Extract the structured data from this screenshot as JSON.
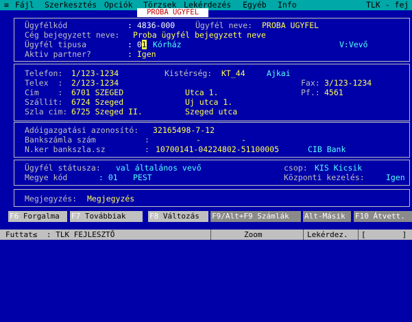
{
  "menu": {
    "system": "≡",
    "items": [
      "Fájl",
      "Szerkesztés",
      "Opciók",
      "Törzsek",
      "Lekérdezés",
      "Egyéb",
      "Info"
    ],
    "right": "TLK - fej"
  },
  "window_title": "PROBA UGYFEL",
  "section1": {
    "ugyfelkod_label": "Ügyfélkód",
    "ugyfelkod_value": ": 4836-000",
    "ugyfelnev_label": "Ügyfél neve:",
    "ugyfelnev_value": "PROBA UGYFEL",
    "ceg_label": "Cég bejegyzett neve:",
    "ceg_value": "Proba ügyfél bejegyzett neve",
    "tipus_label": "Ügyfél tipusa",
    "tipus_colon": ": 0",
    "tipus_cursor": "1",
    "tipus_desc": "Kórház",
    "vevo_value": "V:Vevő",
    "partner_label": "Aktiv partner?",
    "partner_value": ": Igen"
  },
  "section2": {
    "telefon_label": "Telefon:",
    "telefon_value": "1/123-1234",
    "kisterseg_label": "Kistérség:",
    "kisterseg_value": "KT_44",
    "kisterseg_desc": "Ajkai",
    "telex_label": "Telex  :",
    "telex_value": "2/123-1234",
    "fax_label": "Fax:",
    "fax_value": "3/123-1234",
    "cim_label": "Cim    :",
    "cim_value": "6701 SZEGED",
    "cim_utca": "Utca 1.",
    "pf_label": "Pf.:",
    "pf_value": "4561",
    "szallit_label": "Szállit:",
    "szallit_value": "6724 Szeged",
    "szallit_utca": "Uj utca 1.",
    "szla_label": "Szla cim:",
    "szla_value": "6725 Szeged II.",
    "szla_utca": "Szeged utca"
  },
  "section3": {
    "adoig_label": "Adóigazgatási azonosító:",
    "adoig_value": "32165498-7-12",
    "bank_label": "Bankszámla szám",
    "bank_colon": ":",
    "bank_dash1": "-",
    "bank_dash2": "-",
    "nker_label": "N.ker bankszla.sz",
    "nker_colon": ":",
    "nker_value": "10700141-04224802-51100005",
    "nker_bank": "CIB Bank"
  },
  "section4": {
    "statusz_label": "Ügyfél státusza:",
    "statusz_value": "val általános vevő",
    "csop_label": "csop:",
    "csop_value": "KIS Kicsik",
    "megye_label": "Megye kód",
    "megye_colon": ": 01",
    "megye_value": "PEST",
    "kozponti_label": "Központi kezelés:",
    "kozponti_value": "Igen"
  },
  "section5": {
    "megj_label": "Megjegyzés:",
    "megj_value": "Megjegyzés"
  },
  "fkeys": [
    {
      "key": "F6",
      "label": " Forgalma"
    },
    {
      "key": "F7",
      "label": " Továbbiak"
    },
    {
      "key": "F8",
      "label": " Változás"
    },
    {
      "key": "F9/Alt+F9",
      "label": " Számlák"
    },
    {
      "key": "Alt-M",
      "label": "ásik"
    },
    {
      "key": "F10",
      "label": " Átvett."
    }
  ],
  "status": {
    "futtat": "Futtat≤",
    "user": ": TLK FEJLESZTŐ",
    "zoom": "Zoom",
    "lekerdez": "Lekérdez.",
    "bracket": "[        ]"
  }
}
